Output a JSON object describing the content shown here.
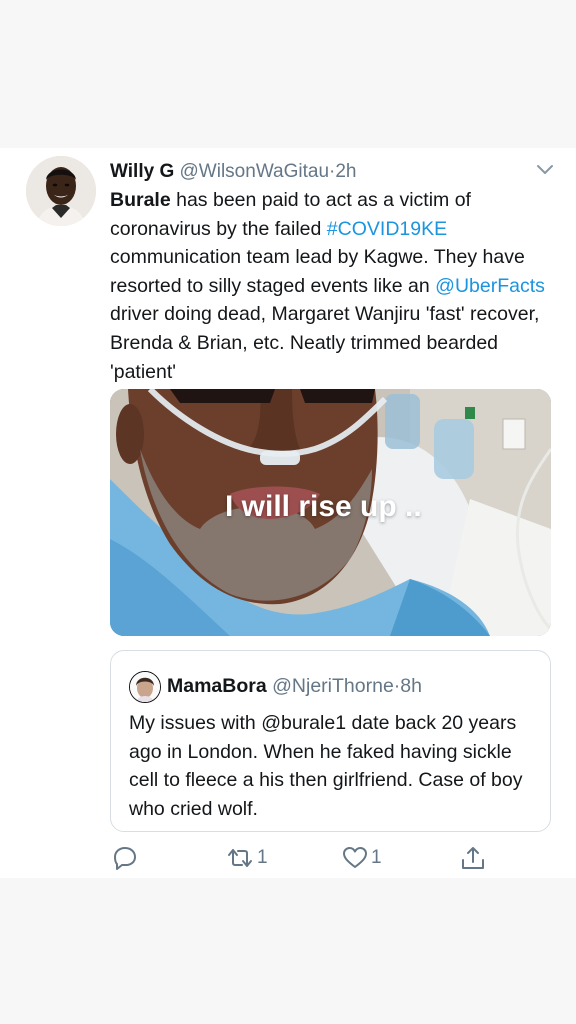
{
  "tweet": {
    "author_name": "Willy G",
    "handle": "@WilsonWaGitau",
    "separator": "·",
    "time": "2h",
    "text_part1": "Burale",
    "text_part2": " has been paid to act as a victim of coronavirus by the failed ",
    "hashtag": "#COVID19KE",
    "text_part3": " communication team lead by Kagwe. They have resorted to silly staged events like an ",
    "mention": "@UberFacts",
    "text_part4": " driver doing dead, Margaret Wanjiru 'fast' recover, Brenda & Brian, etc. Neatly trimmed bearded 'patient'",
    "media_overlay_text": "I will rise up .."
  },
  "quoted_tweet": {
    "author_name": "MamaBora",
    "handle": "@NjeriThorne",
    "separator": "·",
    "time": "8h",
    "text": "My issues with @burale1 date back 20 years ago in London. When he faked having sickle cell to fleece a his then girlfriend. Case of boy who cried wolf."
  },
  "actions": {
    "reply_icon": "reply-icon",
    "retweet_icon": "retweet-icon",
    "retweet_count": "1",
    "like_icon": "heart-icon",
    "like_count": "1",
    "share_icon": "share-icon"
  },
  "colors": {
    "link": "#1b95e0",
    "secondary_text": "#657786",
    "primary_text": "#14171a",
    "border": "#d8dee3"
  }
}
